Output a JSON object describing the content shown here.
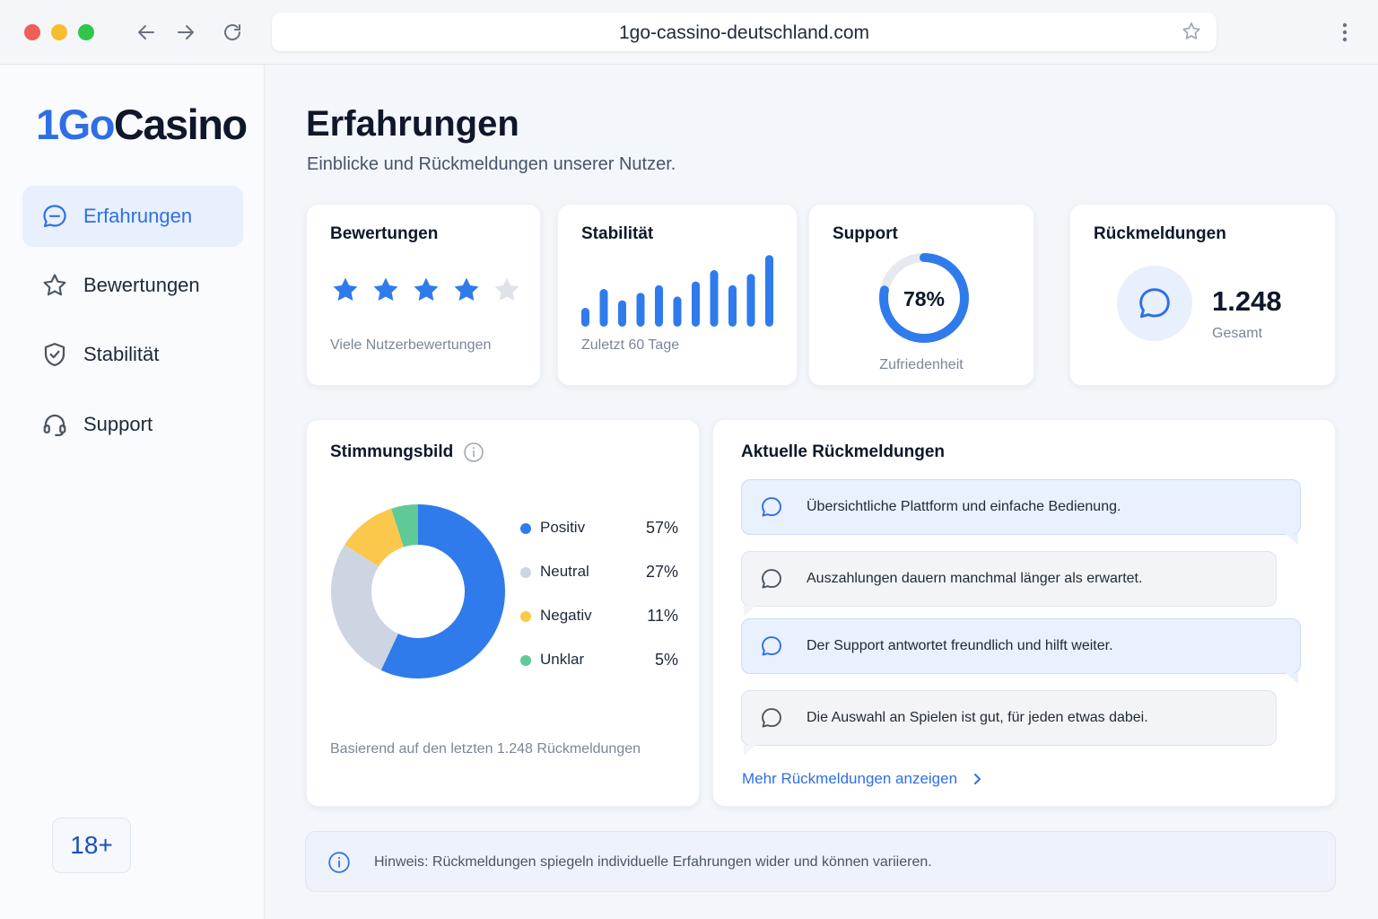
{
  "browser": {
    "url": "1go-cassino-deutschland.com"
  },
  "sidebar": {
    "logo_part1": "1Go",
    "logo_part2": "Casino",
    "items": [
      {
        "label": "Erfahrungen",
        "icon": "chat-bubble-icon",
        "active": true
      },
      {
        "label": "Bewertungen",
        "icon": "star-icon",
        "active": false
      },
      {
        "label": "Stabilität",
        "icon": "shield-check-icon",
        "active": false
      },
      {
        "label": "Support",
        "icon": "headset-icon",
        "active": false
      }
    ],
    "age_badge": "18+"
  },
  "main": {
    "title": "Erfahrungen",
    "subtitle": "Einblicke und Rückmeldungen unserer Nutzer."
  },
  "cards": {
    "ratings": {
      "title": "Bewertungen",
      "stars_filled": 4,
      "stars_total": 5,
      "caption": "Viele Nutzerbewertungen"
    },
    "stability": {
      "title": "Stabilität",
      "caption": "Zuletzt 60 Tage",
      "bar_levels": [
        0.25,
        0.5,
        0.35,
        0.45,
        0.55,
        0.4,
        0.6,
        0.75,
        0.55,
        0.7,
        0.95
      ]
    },
    "support": {
      "title": "Support",
      "percent_label": "78%",
      "percent_value": 78,
      "caption": "Zufriedenheit"
    },
    "feedback_count": {
      "title": "Rückmeldungen",
      "value": "1.248",
      "caption": "Gesamt"
    }
  },
  "sentiment": {
    "title": "Stimmungsbild",
    "basis": "Basierend auf den letzten 1.248 Rückmeldungen",
    "chart_data": {
      "type": "pie",
      "categories": [
        "Positiv",
        "Neutral",
        "Negativ",
        "Unklar"
      ],
      "values": [
        57,
        27,
        11,
        5
      ],
      "value_labels": [
        "57%",
        "27%",
        "11%",
        "5%"
      ],
      "colors": [
        "#2f7bec",
        "#cdd5e3",
        "#fbc84b",
        "#5fc997"
      ]
    }
  },
  "recent": {
    "title": "Aktuelle Rückmeldungen",
    "items": [
      {
        "text": "Übersichtliche Plattform und einfache Bedienung.",
        "style": "blue"
      },
      {
        "text": "Auszahlungen dauern manchmal länger als erwartet.",
        "style": "gray"
      },
      {
        "text": "Der Support antwortet freundlich und hilft weiter.",
        "style": "blue"
      },
      {
        "text": "Die Auswahl an Spielen ist gut, für jeden etwas dabei.",
        "style": "gray"
      }
    ],
    "more_label": "Mehr Rückmeldungen anzeigen"
  },
  "note": {
    "text": "Hinweis: Rückmeldungen spiegeln individuelle Erfahrungen wider und können variieren."
  },
  "colors": {
    "accent": "#2f6fe6",
    "bar": "#2f7bec",
    "track": "#e6e9ee",
    "star_empty": "#dfe3e9"
  }
}
